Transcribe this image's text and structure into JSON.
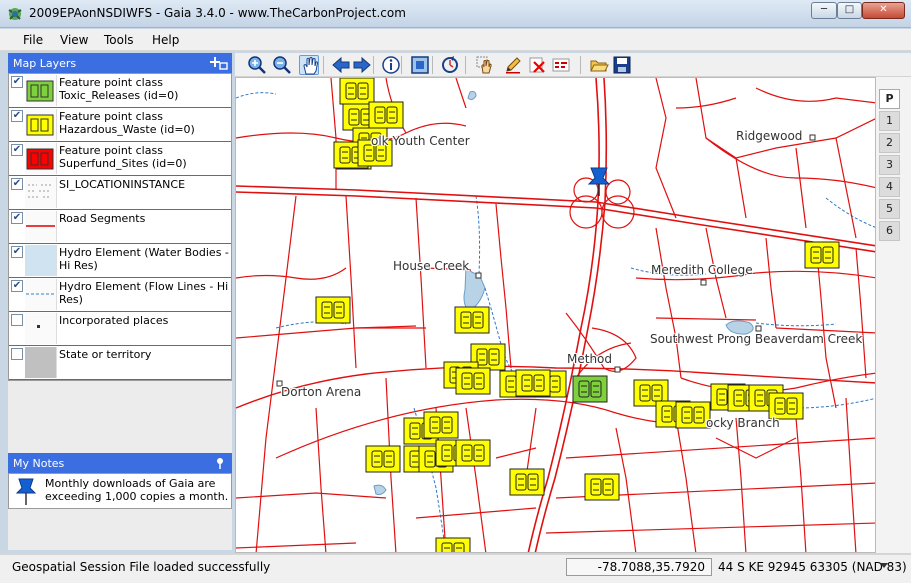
{
  "window": {
    "title": "2009EPAonNSDIWFS - Gaia 3.4.0 - www.TheCarbonProject.com",
    "icons": {
      "app": "gaia-app-icon",
      "minimize": "minimize-icon",
      "maximize": "maximize-icon",
      "close": "close-icon"
    }
  },
  "menu": {
    "items": [
      "File",
      "View",
      "Tools",
      "Help"
    ]
  },
  "layers_panel": {
    "title": "Map Layers",
    "add_icon": "add-layer-icon",
    "layers": [
      {
        "label": "Feature point class Toxic_Releases (id=0)",
        "checked": true,
        "swatch_color": "#7ed03d"
      },
      {
        "label": "Feature point class Hazardous_Waste (id=0)",
        "checked": true,
        "swatch_color": "#ffff00"
      },
      {
        "label": "Feature point class Superfund_Sites (id=0)",
        "checked": true,
        "swatch_color": "#ff0000"
      },
      {
        "label": "SI_LOCATIONINSTANCE",
        "checked": true,
        "swatch_color": "#ffffff"
      },
      {
        "label": "Road Segments",
        "checked": true,
        "swatch_color": "#e00000"
      },
      {
        "label": "Hydro Element (Water Bodies - Hi Res)",
        "checked": true,
        "swatch_color": "#cfe3f0"
      },
      {
        "label": "Hydro Element (Flow Lines - Hi Res)",
        "checked": true,
        "swatch_color": "#2f7fd0"
      },
      {
        "label": "Incorporated places",
        "checked": false,
        "swatch_color": "#ffffff"
      },
      {
        "label": "State or territory",
        "checked": false,
        "swatch_color": "#c0c0c0"
      }
    ]
  },
  "notes_panel": {
    "title": "My Notes",
    "pin_icon": "pin-icon",
    "notes": [
      {
        "text": "Monthly downloads of Gaia are exceeding 1,000 copies a month."
      }
    ]
  },
  "toolbar": {
    "buttons": [
      {
        "name": "zoom-in",
        "icon": "zoom-in-icon",
        "active": false
      },
      {
        "name": "zoom-out",
        "icon": "zoom-out-icon",
        "active": false
      },
      {
        "name": "pan",
        "icon": "pan-hand-icon",
        "active": true
      },
      {
        "name": "back",
        "icon": "arrow-left-icon",
        "active": false
      },
      {
        "name": "forward",
        "icon": "arrow-right-icon",
        "active": false
      },
      {
        "name": "info",
        "icon": "info-icon",
        "active": false
      },
      {
        "name": "full-extent",
        "icon": "full-extent-icon",
        "active": false
      },
      {
        "name": "refresh",
        "icon": "refresh-icon",
        "active": false
      },
      {
        "name": "select",
        "icon": "select-hand-icon",
        "active": false
      },
      {
        "name": "edit",
        "icon": "pencil-icon",
        "active": false
      },
      {
        "name": "delete",
        "icon": "delete-icon",
        "active": false
      },
      {
        "name": "edit-attributes",
        "icon": "edit-label-icon",
        "active": false
      },
      {
        "name": "open",
        "icon": "open-folder-icon",
        "active": false
      },
      {
        "name": "save",
        "icon": "save-disk-icon",
        "active": false
      }
    ]
  },
  "map": {
    "labels": [
      "olk Youth Center",
      "Ridgewood",
      "House Creek",
      "Meredith College",
      "Southwest Prong Beaverdam Creek",
      "Method",
      "Dorton Arena",
      "ocky Branch"
    ],
    "colors": {
      "roads": "#e01010",
      "water": "#b9d3e6",
      "streams": "#2f78c8",
      "hazardous_waste": "#ffff00",
      "toxic_releases": "#7ed03d"
    }
  },
  "page_tabs": [
    "P",
    "1",
    "2",
    "3",
    "4",
    "5",
    "6"
  ],
  "status": {
    "message": "Geospatial Session File loaded successfully",
    "coordinates": "-78.7088,35.7920",
    "grid": "44 S KE 92945 63305 (NAD 83)",
    "dropdown_icon": "chevron-down-icon"
  }
}
